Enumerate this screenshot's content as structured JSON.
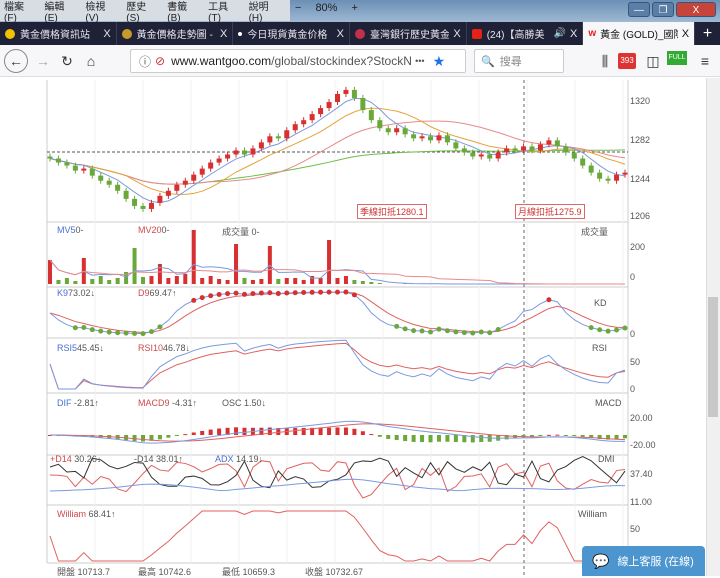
{
  "menu": [
    "檔案 (F)",
    "編輯 (E)",
    "檢視 (V)",
    "歷史 (S)",
    "書籤 (B)",
    "工具 (T)",
    "說明 (H)"
  ],
  "zoom": {
    "minus": "−",
    "level": "80%",
    "plus": "+"
  },
  "window_controls": {
    "minimize": "—",
    "maximize": "❐",
    "close": "X"
  },
  "tabs": [
    {
      "label": "黃金價格資訊站",
      "icon_color": "#f2c200",
      "active": false
    },
    {
      "label": "黃金價格走勢圖 -",
      "icon_color": "#c89a2a",
      "active": false
    },
    {
      "label": "今日現貨黃金价格",
      "icon_color": "#ffffff",
      "active": false
    },
    {
      "label": "臺灣銀行歷史黃金",
      "icon_color": "#c0304a",
      "active": false
    },
    {
      "label": "(24)【高勝美",
      "icon_color": "#e62117",
      "active": false
    },
    {
      "label": "黃金 (GOLD)_國際",
      "icon_color": "#e02020",
      "active": true
    }
  ],
  "close_glyph": "X",
  "new_tab": "+",
  "nav": {
    "url_domain": "www.wantgoo.com",
    "url_path": "/global/stockindex?StockNo",
    "search_placeholder": "搜尋",
    "badge": "393",
    "full_badge": "FULL",
    "more": "•••"
  },
  "chart": {
    "price_ticks": [
      "1320",
      "1282",
      "1244",
      "1206"
    ],
    "annotations": {
      "season": "季線扣抵1280.1",
      "month": "月線扣抵1275.9"
    },
    "volume": {
      "mv5": "MV5",
      "mv5_val": "0-",
      "mv20": "MV20",
      "mv20_val": "0-",
      "vol": "成交量 0-",
      "title": "成交量",
      "ticks": [
        "200",
        "0"
      ]
    },
    "kd": {
      "k": "K9",
      "k_val": "73.02↓",
      "d": "D9",
      "d_val": "69.47↑",
      "title": "KD",
      "ticks": [
        "0"
      ]
    },
    "rsi": {
      "r5": "RSI5",
      "r5_val": "45.45↓",
      "r10": "RSI10",
      "r10_val": "46.78↓",
      "title": "RSI",
      "ticks": [
        "50",
        "0"
      ]
    },
    "macd": {
      "dif": "DIF",
      "dif_val": "-2.81↑",
      "macd": "MACD9",
      "macd_val": "-4.31↑",
      "osc": "OSC 1.50↓",
      "title": "MACD",
      "ticks": [
        "20.00",
        "-20.00"
      ]
    },
    "dmi": {
      "pdi": "+D14",
      "pdi_val": "30.26↓",
      "mdi": "-D14",
      "mdi_val": "38.01↑",
      "adx": "ADX",
      "adx_val": "14.19↓",
      "title": "DMI",
      "ticks": [
        "37.40",
        "11.00"
      ]
    },
    "william": {
      "label": "William",
      "val": "68.41↑",
      "title": "William",
      "ticks": [
        "50"
      ]
    },
    "ohlc": {
      "open": "開盤 10713.7",
      "high": "最高 10742.6",
      "low": "最低 10659.3",
      "close": "收盤 10732.67"
    }
  },
  "chart_data": {
    "type": "candlestick",
    "closes": [
      1262,
      1258,
      1255,
      1250,
      1252,
      1245,
      1240,
      1236,
      1230,
      1222,
      1215,
      1212,
      1218,
      1225,
      1230,
      1236,
      1240,
      1246,
      1252,
      1258,
      1262,
      1266,
      1270,
      1266,
      1272,
      1278,
      1284,
      1282,
      1290,
      1296,
      1300,
      1306,
      1312,
      1318,
      1326,
      1330,
      1322,
      1310,
      1300,
      1292,
      1288,
      1292,
      1286,
      1282,
      1284,
      1280,
      1285,
      1278,
      1272,
      1268,
      1264,
      1266,
      1262,
      1268,
      1272,
      1270,
      1274,
      1270,
      1276,
      1280,
      1274,
      1268,
      1262,
      1255,
      1248,
      1242,
      1240,
      1246,
      1248
    ],
    "volume": [
      120,
      20,
      30,
      15,
      130,
      25,
      40,
      20,
      30,
      60,
      180,
      35,
      40,
      100,
      30,
      40,
      50,
      270,
      30,
      40,
      25,
      20,
      200,
      30,
      20,
      25,
      190,
      25,
      30,
      30,
      20,
      40,
      30,
      220,
      30,
      40,
      20,
      15,
      10,
      5,
      0,
      0,
      5,
      0,
      0,
      0,
      0,
      0,
      0,
      0,
      0,
      0,
      0,
      0,
      0,
      0,
      0,
      0,
      0,
      0,
      0,
      0,
      0,
      0,
      0,
      0,
      0,
      0,
      0
    ],
    "ylim": [
      1190,
      1345
    ]
  },
  "chat": {
    "label": "線上客服 (在線)"
  }
}
